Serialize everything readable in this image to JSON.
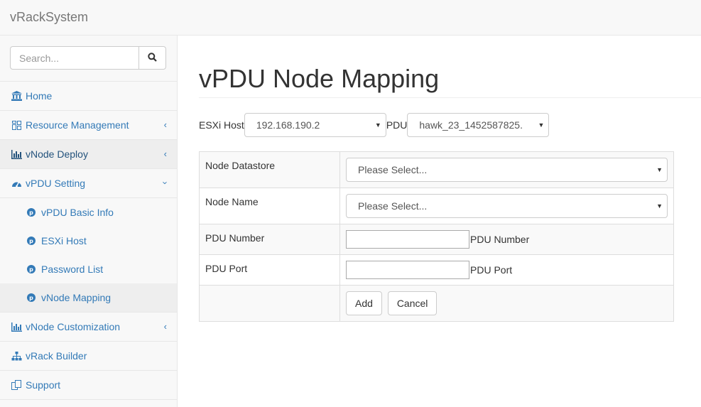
{
  "app": {
    "brand": "vRackSystem"
  },
  "search": {
    "placeholder": "Search..."
  },
  "sidebar": {
    "items": [
      {
        "label": "Home"
      },
      {
        "label": "Resource Management"
      },
      {
        "label": "vNode Deploy"
      },
      {
        "label": "vPDU Setting"
      },
      {
        "label": "vNode Customization"
      },
      {
        "label": "vRack Builder"
      },
      {
        "label": "Support"
      }
    ],
    "sub_items": [
      {
        "label": "vPDU Basic Info"
      },
      {
        "label": "ESXi Host"
      },
      {
        "label": "Password List"
      },
      {
        "label": "vNode Mapping"
      }
    ]
  },
  "main": {
    "title": "vPDU Node Mapping",
    "filters": {
      "esxi_label": "ESXi Host",
      "esxi_value": "192.168.190.2",
      "pdu_label": "PDU",
      "pdu_value": "hawk_23_1452587825."
    },
    "form": {
      "datastore_label": "Node Datastore",
      "datastore_value": "Please Select...",
      "name_label": "Node Name",
      "name_value": "Please Select...",
      "pdu_number_label": "PDU Number",
      "pdu_number_suffix": "PDU Number",
      "pdu_port_label": "PDU Port",
      "pdu_port_suffix": "PDU Port",
      "add_label": "Add",
      "cancel_label": "Cancel"
    }
  },
  "colors": {
    "link": "#337ab7",
    "link_active": "#23527c",
    "sidebar_bg": "#f8f8f8"
  }
}
